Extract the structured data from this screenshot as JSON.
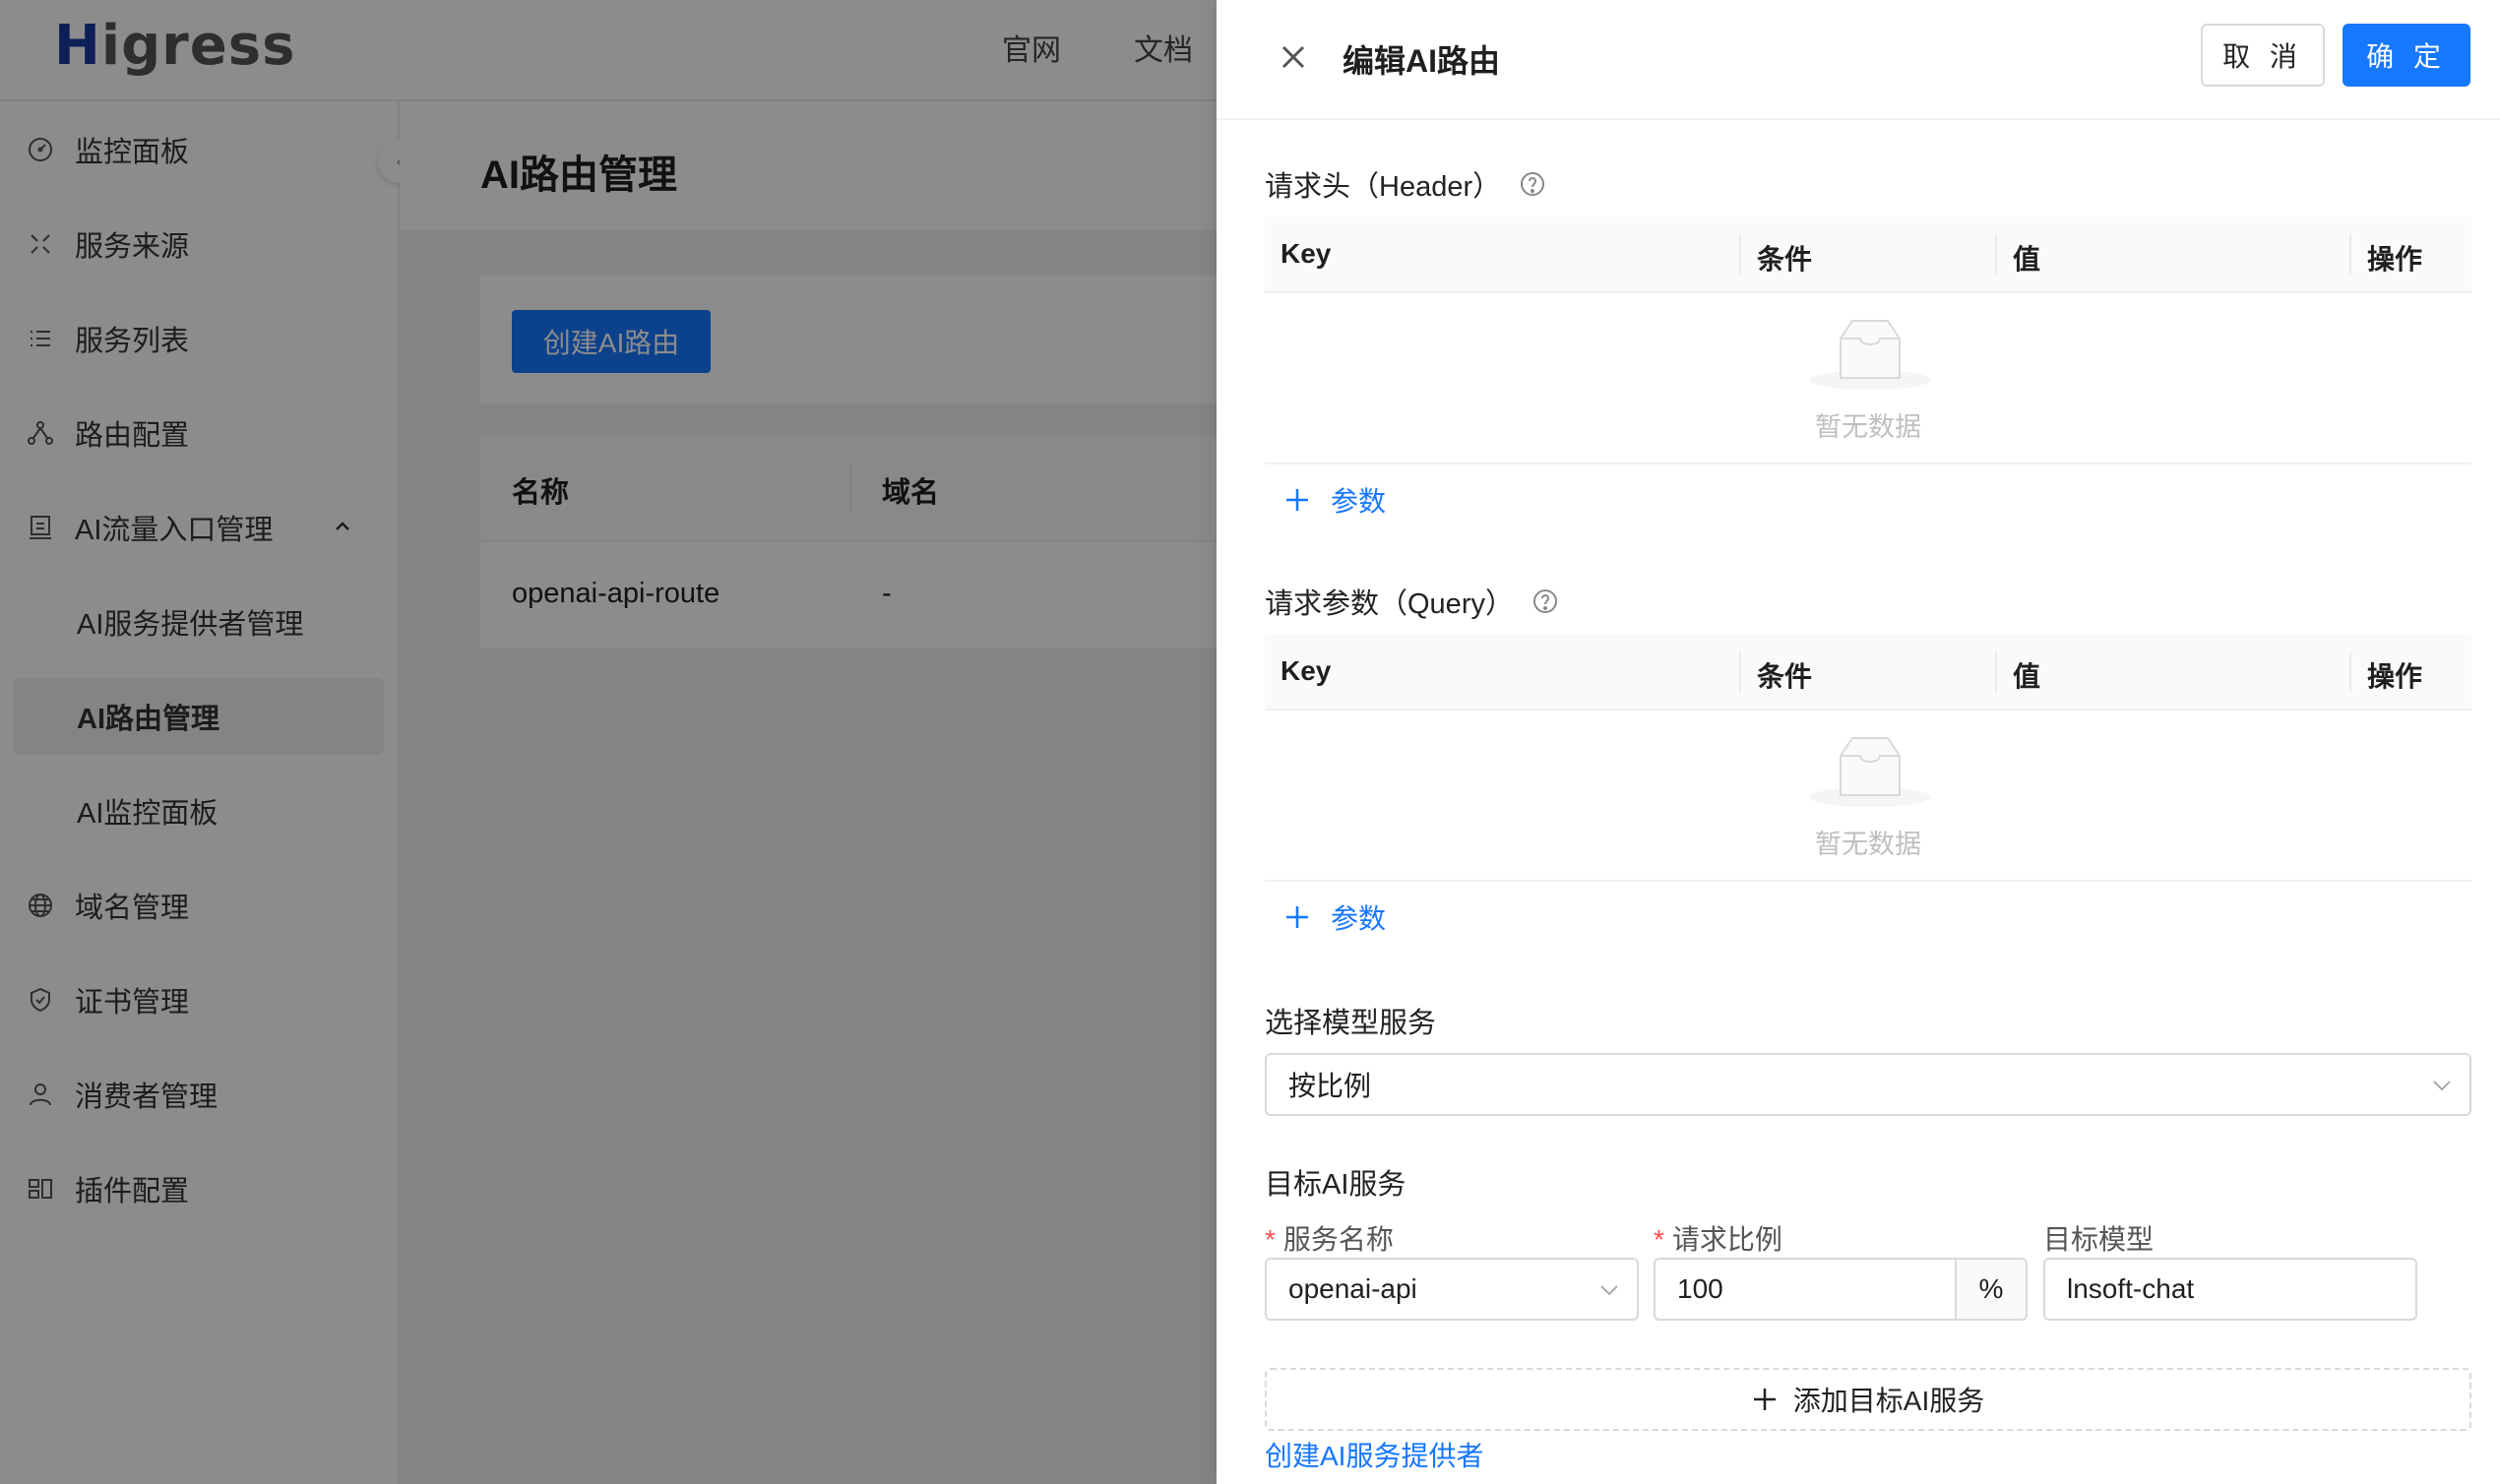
{
  "app": {
    "logo": "igress",
    "logo_h": "H",
    "topnav": [
      "官网",
      "文档"
    ],
    "sidebar": {
      "items": [
        {
          "label": "监控面板",
          "icon": "dashboard-icon"
        },
        {
          "label": "服务来源",
          "icon": "source-icon"
        },
        {
          "label": "服务列表",
          "icon": "list-icon"
        },
        {
          "label": "路由配置",
          "icon": "route-icon"
        },
        {
          "label": "AI流量入口管理",
          "icon": "ai-gateway-icon"
        },
        {
          "label": "AI服务提供者管理"
        },
        {
          "label": "AI路由管理"
        },
        {
          "label": "AI监控面板"
        },
        {
          "label": "域名管理",
          "icon": "globe-icon"
        },
        {
          "label": "证书管理",
          "icon": "shield-icon"
        },
        {
          "label": "消费者管理",
          "icon": "user-icon"
        },
        {
          "label": "插件配置",
          "icon": "plugin-icon"
        }
      ]
    },
    "page_title": "AI路由管理",
    "create_button": "创建AI路由",
    "table": {
      "columns": [
        "名称",
        "域名"
      ],
      "rows": [
        [
          "openai-api-route",
          "-"
        ]
      ]
    }
  },
  "drawer": {
    "title": "编辑AI路由",
    "cancel": "取 消",
    "ok": "确 定",
    "header_section": {
      "label": "请求头（Header）",
      "columns": [
        "Key",
        "条件",
        "值",
        "操作"
      ],
      "empty": "暂无数据",
      "add": "参数"
    },
    "query_section": {
      "label": "请求参数（Query）",
      "columns": [
        "Key",
        "条件",
        "值",
        "操作"
      ],
      "empty": "暂无数据",
      "add": "参数"
    },
    "model_service": {
      "label": "选择模型服务",
      "value": "按比例"
    },
    "target": {
      "label": "目标AI服务",
      "service_name_label": "服务名称",
      "service_name_value": "openai-api",
      "ratio_label": "请求比例",
      "ratio_value": "100",
      "ratio_unit": "%",
      "model_label": "目标模型",
      "model_value": "lnsoft-chat",
      "add_target": "添加目标AI服务",
      "create_provider_link": "创建AI服务提供者"
    }
  },
  "colors": {
    "primary": "#1677ff",
    "required": "#ff4d4f",
    "mask": "rgba(0,0,0,0.45)"
  }
}
